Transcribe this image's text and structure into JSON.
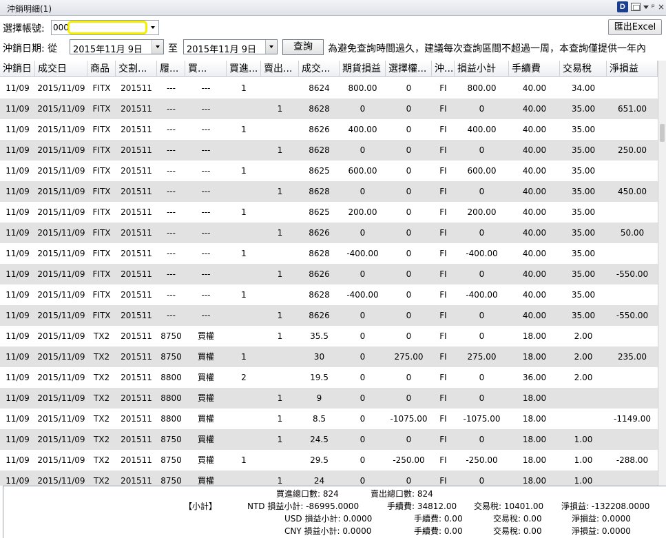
{
  "window": {
    "title": "沖銷明細(1)"
  },
  "account": {
    "label": "選擇帳號:",
    "prefix": "000",
    "value": ""
  },
  "excel_button": "匯出Excel",
  "date_filter": {
    "label": "沖銷日期: 從",
    "from": "2015年11月  9日",
    "to_label": "至",
    "to": "2015年11月  9日",
    "query_button": "查詢",
    "notice": "為避免查詢時間過久，建議每次查詢區間不超過一周，本查詢僅提供一年內"
  },
  "columns": [
    "沖銷日",
    "成交日",
    "商品",
    "交割...",
    "履...",
    "買...",
    "買進...",
    "賣出...",
    "成交...",
    "期貨損益",
    "選擇權...",
    "沖...",
    "損益小計",
    "手續費",
    "交易稅",
    "淨損益"
  ],
  "rows": [
    [
      "11/09",
      "2015/11/09",
      "FITX",
      "201511",
      "---",
      "---",
      "1",
      "",
      "8624",
      "800.00",
      "0",
      "FI",
      "800.00",
      "40.00",
      "34.00",
      ""
    ],
    [
      "11/09",
      "2015/11/09",
      "FITX",
      "201511",
      "---",
      "---",
      "",
      "1",
      "8628",
      "0",
      "0",
      "FI",
      "0",
      "40.00",
      "35.00",
      "651.00"
    ],
    [
      "11/09",
      "2015/11/09",
      "FITX",
      "201511",
      "---",
      "---",
      "1",
      "",
      "8626",
      "400.00",
      "0",
      "FI",
      "400.00",
      "40.00",
      "35.00",
      ""
    ],
    [
      "11/09",
      "2015/11/09",
      "FITX",
      "201511",
      "---",
      "---",
      "",
      "1",
      "8628",
      "0",
      "0",
      "FI",
      "0",
      "40.00",
      "35.00",
      "250.00"
    ],
    [
      "11/09",
      "2015/11/09",
      "FITX",
      "201511",
      "---",
      "---",
      "1",
      "",
      "8625",
      "600.00",
      "0",
      "FI",
      "600.00",
      "40.00",
      "35.00",
      ""
    ],
    [
      "11/09",
      "2015/11/09",
      "FITX",
      "201511",
      "---",
      "---",
      "",
      "1",
      "8628",
      "0",
      "0",
      "FI",
      "0",
      "40.00",
      "35.00",
      "450.00"
    ],
    [
      "11/09",
      "2015/11/09",
      "FITX",
      "201511",
      "---",
      "---",
      "1",
      "",
      "8625",
      "200.00",
      "0",
      "FI",
      "200.00",
      "40.00",
      "35.00",
      ""
    ],
    [
      "11/09",
      "2015/11/09",
      "FITX",
      "201511",
      "---",
      "---",
      "",
      "1",
      "8626",
      "0",
      "0",
      "FI",
      "0",
      "40.00",
      "35.00",
      "50.00"
    ],
    [
      "11/09",
      "2015/11/09",
      "FITX",
      "201511",
      "---",
      "---",
      "1",
      "",
      "8628",
      "-400.00",
      "0",
      "FI",
      "-400.00",
      "40.00",
      "35.00",
      ""
    ],
    [
      "11/09",
      "2015/11/09",
      "FITX",
      "201511",
      "---",
      "---",
      "",
      "1",
      "8626",
      "0",
      "0",
      "FI",
      "0",
      "40.00",
      "35.00",
      "-550.00"
    ],
    [
      "11/09",
      "2015/11/09",
      "FITX",
      "201511",
      "---",
      "---",
      "1",
      "",
      "8628",
      "-400.00",
      "0",
      "FI",
      "-400.00",
      "40.00",
      "35.00",
      ""
    ],
    [
      "11/09",
      "2015/11/09",
      "FITX",
      "201511",
      "---",
      "---",
      "",
      "1",
      "8626",
      "0",
      "0",
      "FI",
      "0",
      "40.00",
      "35.00",
      "-550.00"
    ],
    [
      "11/09",
      "2015/11/09",
      "TX2",
      "201511",
      "8750",
      "買權",
      "",
      "1",
      "35.5",
      "0",
      "0",
      "FI",
      "0",
      "18.00",
      "2.00",
      ""
    ],
    [
      "11/09",
      "2015/11/09",
      "TX2",
      "201511",
      "8750",
      "買權",
      "1",
      "",
      "30",
      "0",
      "275.00",
      "FI",
      "275.00",
      "18.00",
      "2.00",
      "235.00"
    ],
    [
      "11/09",
      "2015/11/09",
      "TX2",
      "201511",
      "8800",
      "買權",
      "2",
      "",
      "19.5",
      "0",
      "0",
      "FI",
      "0",
      "36.00",
      "2.00",
      ""
    ],
    [
      "11/09",
      "2015/11/09",
      "TX2",
      "201511",
      "8800",
      "買權",
      "",
      "1",
      "9",
      "0",
      "0",
      "FI",
      "0",
      "18.00",
      "",
      ""
    ],
    [
      "11/09",
      "2015/11/09",
      "TX2",
      "201511",
      "8800",
      "買權",
      "",
      "1",
      "8.5",
      "0",
      "-1075.00",
      "FI",
      "-1075.00",
      "18.00",
      "",
      "-1149.00"
    ],
    [
      "11/09",
      "2015/11/09",
      "TX2",
      "201511",
      "8750",
      "買權",
      "",
      "1",
      "24.5",
      "0",
      "0",
      "FI",
      "0",
      "18.00",
      "1.00",
      ""
    ],
    [
      "11/09",
      "2015/11/09",
      "TX2",
      "201511",
      "8750",
      "買權",
      "1",
      "",
      "29.5",
      "0",
      "-250.00",
      "FI",
      "-250.00",
      "18.00",
      "1.00",
      "-288.00"
    ],
    [
      "11/09",
      "2015/11/09",
      "TX2",
      "201511",
      "8750",
      "買權",
      "",
      "1",
      "24",
      "0",
      "0",
      "FI",
      "0",
      "18.00",
      "1.00",
      ""
    ]
  ],
  "summary": {
    "buy_total": "買進總口數: 824",
    "sell_total": "賣出總口數: 824",
    "subtotal_label": "【小計】",
    "ntd": {
      "pl": "NTD 損益小計: -86995.0000",
      "fee": "手續費: 34812.00",
      "tax": "交易稅: 10401.00",
      "net": "淨損益: -132208.0000"
    },
    "usd": {
      "pl": "USD 損益小計: 0.0000",
      "fee": "手續費: 0.00",
      "tax": "交易稅: 0.00",
      "net": "淨損益: 0.0000"
    },
    "cny": {
      "pl": "CNY 損益小計: 0.0000",
      "fee": "手續費: 0.00",
      "tax": "交易稅: 0.00",
      "net": "淨損益: 0.0000"
    }
  }
}
